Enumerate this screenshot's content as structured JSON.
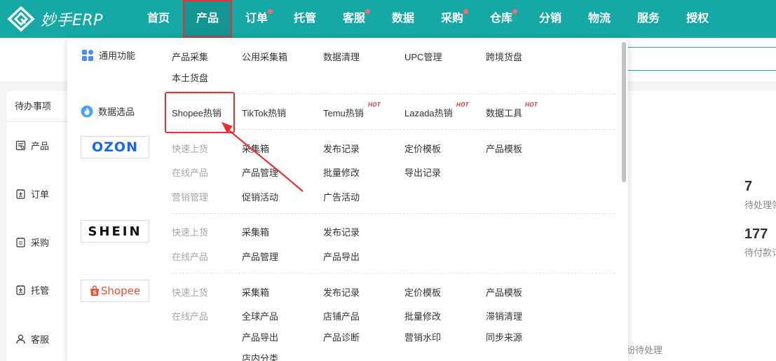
{
  "brand": {
    "name": "妙手ERP"
  },
  "nav": {
    "items": [
      {
        "label": "首页"
      },
      {
        "label": "产品"
      },
      {
        "label": "订单"
      },
      {
        "label": "托管"
      },
      {
        "label": "客服"
      },
      {
        "label": "数据"
      },
      {
        "label": "采购"
      },
      {
        "label": "仓库"
      },
      {
        "label": "分销"
      },
      {
        "label": "物流"
      },
      {
        "label": "服务"
      },
      {
        "label": "授权"
      }
    ]
  },
  "sidebar": {
    "title": "待办事项",
    "items": [
      {
        "label": "产品",
        "icon": "product-icon"
      },
      {
        "label": "订单",
        "icon": "order-icon"
      },
      {
        "label": "采购",
        "icon": "purchase-icon"
      },
      {
        "label": "托管",
        "icon": "hosting-icon"
      },
      {
        "label": "客服",
        "icon": "service-icon"
      }
    ]
  },
  "stats": [
    {
      "num": "7",
      "label": "待处理领"
    },
    {
      "num": "177",
      "label": "待付款订"
    }
  ],
  "bottom_note": "纷待处理",
  "menu": {
    "general": {
      "label": "通用功能",
      "links": [
        "产品采集",
        "公用采集箱",
        "数据清理",
        "UPC管理",
        "跨境货盘",
        "本土货盘"
      ]
    },
    "data_select": {
      "label": "数据选品",
      "links": [
        {
          "text": "Shopee热销",
          "hot": ""
        },
        {
          "text": "TikTok热销",
          "hot": ""
        },
        {
          "text": "Temu热销",
          "hot": "HOT"
        },
        {
          "text": "Lazada热销",
          "hot": "HOT"
        },
        {
          "text": "数据工具",
          "hot": "HOT"
        }
      ]
    },
    "ozon": {
      "brand": "OZON",
      "row1": [
        "快速上货",
        "采集箱",
        "发布记录",
        "定价模板",
        "产品模板"
      ],
      "row2": [
        "在线产品",
        "产品管理",
        "批量修改",
        "导出记录"
      ],
      "row3": [
        "营销管理",
        "促销活动",
        "广告活动"
      ]
    },
    "shein": {
      "brand": "SHEIN",
      "row1": [
        "快速上货",
        "采集箱",
        "发布记录"
      ],
      "row2": [
        "在线产品",
        "产品管理",
        "产品导出"
      ]
    },
    "shopee": {
      "brand": "Shopee",
      "row1": [
        "快速上货",
        "采集箱",
        "发布记录",
        "定价模板",
        "产品模板"
      ],
      "row2": [
        "在线产品",
        "全球产品",
        "店铺产品",
        "批量修改",
        "滞销清理"
      ],
      "row3": [
        "产品导出",
        "产品诊断",
        "营销水印",
        "同步来源"
      ],
      "row4": [
        "店内分类"
      ]
    }
  }
}
